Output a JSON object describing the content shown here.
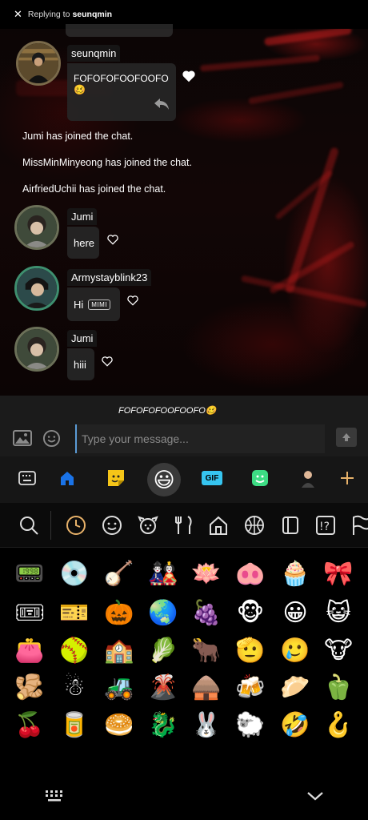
{
  "chat": {
    "messages": [
      {
        "username": "seunqmin",
        "text": "FOFOFOFOOFOOFO🥴"
      },
      {
        "username": "Jumi",
        "text": "here"
      },
      {
        "username": "Armystayblink23",
        "text": "Hi",
        "tag": "MIMI"
      },
      {
        "username": "Jumi",
        "text": "hiii"
      }
    ],
    "system": [
      "Jumi has joined the chat.",
      "MissMinMinyeong has joined the chat.",
      "AirfriedUchii has joined the chat."
    ]
  },
  "reply": {
    "prefix": "Replying to",
    "username": "seunqmin",
    "text": "FOFOFOFOOFOOFO🥴"
  },
  "input": {
    "placeholder": "Type your message..."
  },
  "keyboard": {
    "toolbar": [
      "keyboard-grid-icon",
      "home-icon",
      "sticker-icon",
      "emoji-icon",
      "gif-icon",
      "bitmoji-icon",
      "avatar-icon",
      "plus-icon"
    ],
    "gif_label": "GIF",
    "emoji_face": "😃",
    "categories": [
      "search-icon",
      "recent-clock-icon",
      "smiley-icon",
      "animal-icon",
      "food-icon",
      "house-icon",
      "sports-ball-icon",
      "objects-icon",
      "symbols-icon",
      "flag-icon"
    ],
    "emoji_rows": [
      [
        "📟",
        "💿",
        "🪕",
        "🎎",
        "🪷",
        "🐽",
        "🧁",
        "🎀"
      ],
      [
        "🎟",
        "🎫",
        "🎃",
        "🌏",
        "🍇",
        "🐵",
        "😀",
        "😺"
      ],
      [
        "👛",
        "🥎",
        "🏫",
        "🥬",
        "🐂",
        "🫡",
        "🥲",
        "🐮"
      ],
      [
        "🫚",
        "☃",
        "🚜",
        "🌋",
        "🛖",
        "🍻",
        "🥟",
        "🫑"
      ],
      [
        "🍒",
        "🥫",
        "🥯",
        "🐉",
        "🐰",
        "🐑",
        "🤣",
        "🪝"
      ]
    ]
  },
  "colors": {
    "accent": "#5b9bd5",
    "heart": "#ffffff",
    "home_icon": "#1a73e8",
    "sticker": "#f5c518",
    "gif": "#36c5f0",
    "bitmoji": "#3ddc84"
  }
}
